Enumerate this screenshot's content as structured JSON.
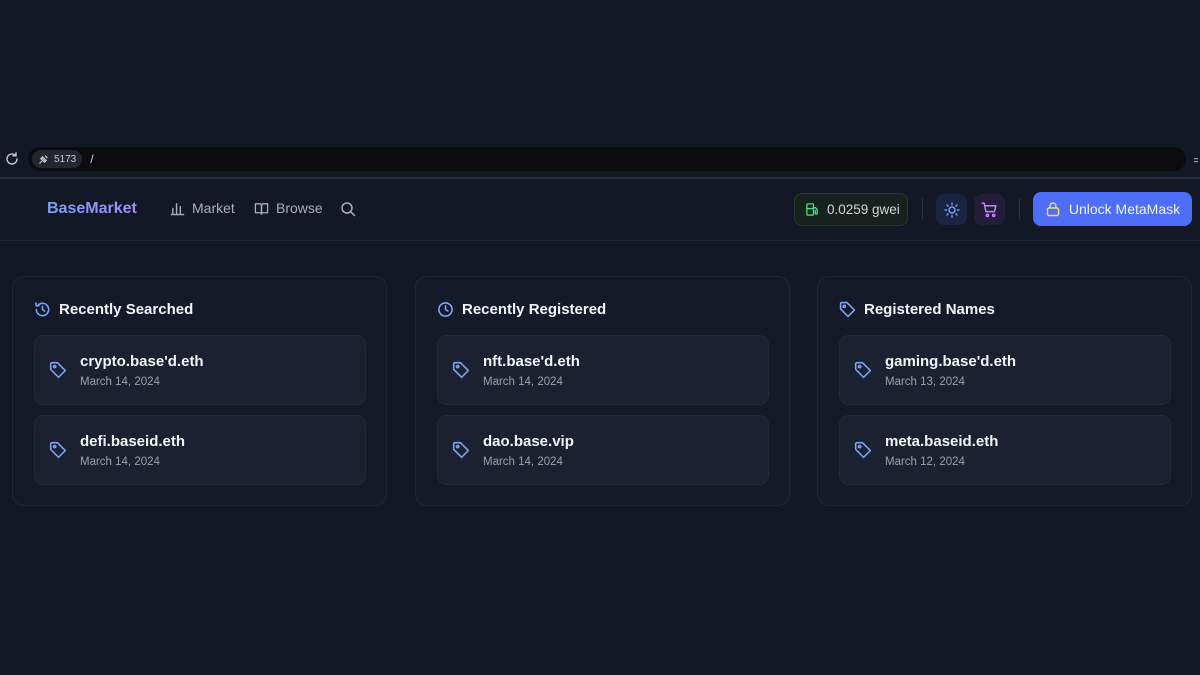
{
  "browser": {
    "port": "5173",
    "path": "/"
  },
  "nav": {
    "brand": "BaseMarket",
    "links": [
      {
        "label": "Market",
        "icon": "bar-chart-icon"
      },
      {
        "label": "Browse",
        "icon": "book-icon"
      }
    ],
    "gas": "0.0259 gwei",
    "unlock_label": "Unlock MetaMask"
  },
  "colors": {
    "accent": "#4f6ef7",
    "icon_blue": "#7aa2f7",
    "gas_green": "#4ade80",
    "cart_purple": "#c084fc"
  },
  "panels": [
    {
      "title": "Recently Searched",
      "icon": "history-icon",
      "items": [
        {
          "name": "crypto.base'd.eth",
          "date": "March 14, 2024"
        },
        {
          "name": "defi.baseid.eth",
          "date": "March 14, 2024"
        }
      ]
    },
    {
      "title": "Recently Registered",
      "icon": "clock-icon",
      "items": [
        {
          "name": "nft.base'd.eth",
          "date": "March 14, 2024"
        },
        {
          "name": "dao.base.vip",
          "date": "March 14, 2024"
        }
      ]
    },
    {
      "title": "Registered Names",
      "icon": "tag-icon",
      "items": [
        {
          "name": "gaming.base'd.eth",
          "date": "March 13, 2024"
        },
        {
          "name": "meta.baseid.eth",
          "date": "March 12, 2024"
        }
      ]
    }
  ]
}
